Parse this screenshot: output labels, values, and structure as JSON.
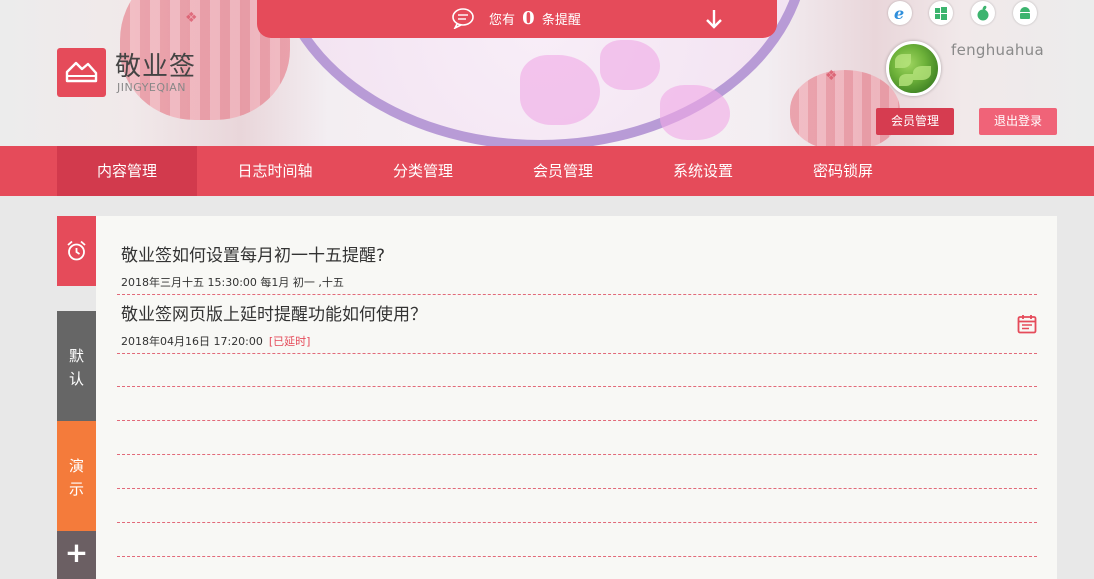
{
  "header": {
    "reminder_prefix": "您有",
    "reminder_count": "0",
    "reminder_suffix": "条提醒",
    "brand_cn": "敬业签",
    "brand_en": "JINGYEQIAN",
    "username": "fenghuahua",
    "member_btn": "会员管理",
    "logout_btn": "退出登录",
    "platform_icons": [
      "ie-icon",
      "windows-icon",
      "apple-icon",
      "android-icon"
    ]
  },
  "nav": {
    "items": [
      "内容管理",
      "日志时间轴",
      "分类管理",
      "会员管理",
      "系统设置",
      "密码锁屏"
    ],
    "active_index": 0
  },
  "sidebar": {
    "default_tab": [
      "默",
      "认"
    ],
    "demo_tab": [
      "演",
      "示"
    ],
    "add_label": "+"
  },
  "notes": [
    {
      "title": "敬业签如何设置每月初一十五提醒?",
      "meta": "2018年三月十五 15:30:00 每1月 初一 ,十五",
      "tag": ""
    },
    {
      "title": "敬业签网页版上延时提醒功能如何使用？",
      "meta": "2018年04月16日 17:20:00",
      "tag": "[已延时]"
    }
  ],
  "colors": {
    "brand_red": "#e54b5a",
    "nav_active": "#d23a4d",
    "tab_default": "#666666",
    "tab_demo": "#f47b3b",
    "tab_add": "#6b5f63"
  }
}
